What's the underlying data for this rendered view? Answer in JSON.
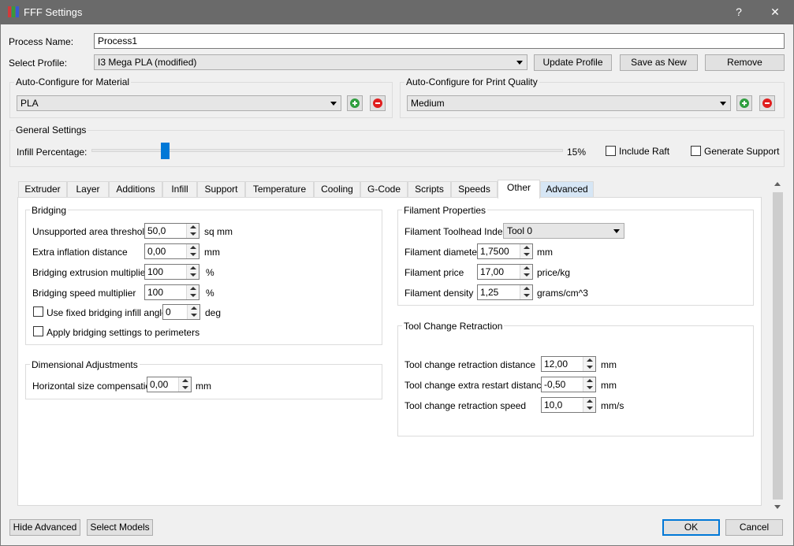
{
  "window": {
    "title": "FFF Settings",
    "help_glyph": "?",
    "close_glyph": "✕"
  },
  "process": {
    "name_label": "Process Name:",
    "name_value": "Process1"
  },
  "profile": {
    "label": "Select Profile:",
    "selected": "I3 Mega PLA (modified)",
    "update_label": "Update Profile",
    "save_as_new_label": "Save as New",
    "remove_label": "Remove"
  },
  "auto_material": {
    "title": "Auto-Configure for Material",
    "selected": "PLA"
  },
  "auto_quality": {
    "title": "Auto-Configure for Print Quality",
    "selected": "Medium"
  },
  "general": {
    "title": "General Settings",
    "infill_label": "Infill Percentage:",
    "infill_value_text": "15%",
    "infill_percent": 15,
    "include_raft_label": "Include Raft",
    "generate_support_label": "Generate Support"
  },
  "tabs": [
    {
      "label": "Extruder"
    },
    {
      "label": "Layer"
    },
    {
      "label": "Additions"
    },
    {
      "label": "Infill"
    },
    {
      "label": "Support"
    },
    {
      "label": "Temperature"
    },
    {
      "label": "Cooling"
    },
    {
      "label": "G-Code"
    },
    {
      "label": "Scripts"
    },
    {
      "label": "Speeds"
    },
    {
      "label": "Other"
    },
    {
      "label": "Advanced"
    }
  ],
  "bridging": {
    "title": "Bridging",
    "rows": [
      {
        "label": "Unsupported area threshold",
        "value": "50,0",
        "unit": "sq mm"
      },
      {
        "label": "Extra inflation distance",
        "value": "0,00",
        "unit": "mm"
      },
      {
        "label": "Bridging extrusion multiplier",
        "value": "100",
        "unit": "%"
      },
      {
        "label": "Bridging speed multiplier",
        "value": "100",
        "unit": "%"
      }
    ],
    "fixed_angle_label": "Use fixed bridging infill angle",
    "fixed_angle_value": "0",
    "fixed_angle_unit": "deg",
    "apply_perimeters_label": "Apply bridging settings to perimeters"
  },
  "dimensional": {
    "title": "Dimensional Adjustments",
    "label": "Horizontal size compensation",
    "value": "0,00",
    "unit": "mm"
  },
  "filament": {
    "title": "Filament Properties",
    "toolhead_label": "Filament Toolhead Index",
    "toolhead_value": "Tool 0",
    "rows": [
      {
        "label": "Filament diameter",
        "value": "1,7500",
        "unit": "mm"
      },
      {
        "label": "Filament price",
        "value": "17,00",
        "unit": "price/kg"
      },
      {
        "label": "Filament density",
        "value": "1,25",
        "unit": "grams/cm^3"
      }
    ]
  },
  "toolchange": {
    "title": "Tool Change Retraction",
    "rows": [
      {
        "label": "Tool change retraction distance",
        "value": "12,00",
        "unit": "mm"
      },
      {
        "label": "Tool change extra restart distance",
        "value": "-0,50",
        "unit": "mm"
      },
      {
        "label": "Tool change retraction speed",
        "value": "10,0",
        "unit": "mm/s"
      }
    ]
  },
  "footer": {
    "hide_advanced_label": "Hide Advanced",
    "select_models_label": "Select Models",
    "ok_label": "OK",
    "cancel_label": "Cancel"
  },
  "colors": {
    "accent": "#0078d7",
    "add_green": "#2e9e3e",
    "remove_red": "#e01e1e",
    "titlebar": "#6a6a6a"
  }
}
